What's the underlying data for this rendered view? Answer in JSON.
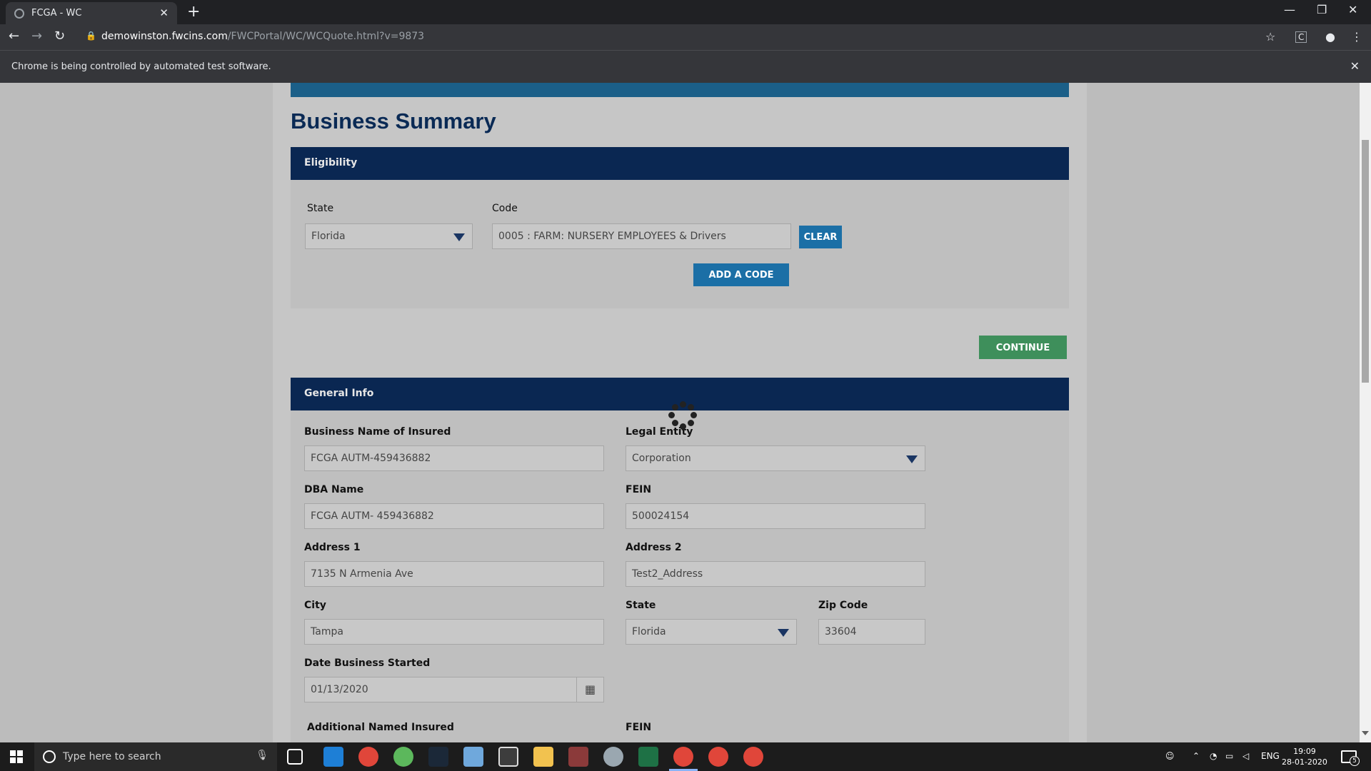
{
  "browser": {
    "tab_title": "FCGA - WC",
    "url_host": "demowinston.fwcins.com",
    "url_path": "/FWCPortal/WC/WCQuote.html?v=9873",
    "infobar_message": "Chrome is being controlled by automated test software."
  },
  "page": {
    "title": "Business Summary",
    "eligibility": {
      "header": "Eligibility",
      "state_label": "State",
      "state_value": "Florida",
      "code_label": "Code",
      "code_value": "0005 : FARM: NURSERY EMPLOYEES & Drivers",
      "clear_label": "CLEAR",
      "add_code_label": "ADD A CODE"
    },
    "continue_label": "CONTINUE",
    "general_info": {
      "header": "General Info",
      "business_name_label": "Business Name of Insured",
      "business_name_value": "FCGA AUTM-459436882",
      "legal_entity_label": "Legal Entity",
      "legal_entity_value": "Corporation",
      "dba_label": "DBA Name",
      "dba_value": "FCGA AUTM- 459436882",
      "fein_label": "FEIN",
      "fein_value": "500024154",
      "address1_label": "Address 1",
      "address1_value": "7135 N Armenia Ave",
      "address2_label": "Address 2",
      "address2_value": "Test2_Address",
      "city_label": "City",
      "city_value": "Tampa",
      "state_label": "State",
      "state_value": "Florida",
      "zip_label": "Zip Code",
      "zip_value": "33604",
      "date_started_label": "Date Business Started",
      "date_started_value": "01/13/2020",
      "additional_insured_label": "Additional Named Insured",
      "additional_fein_label": "FEIN"
    }
  },
  "taskbar": {
    "search_placeholder": "Type here to search",
    "language": "ENG",
    "time": "19:09",
    "date": "28-01-2020",
    "notification_count": "5"
  },
  "colors": {
    "section_header": "#0a2752",
    "primary_button": "#1b6fa6",
    "continue_button": "#3e8f5b",
    "title": "#0a2a55"
  }
}
